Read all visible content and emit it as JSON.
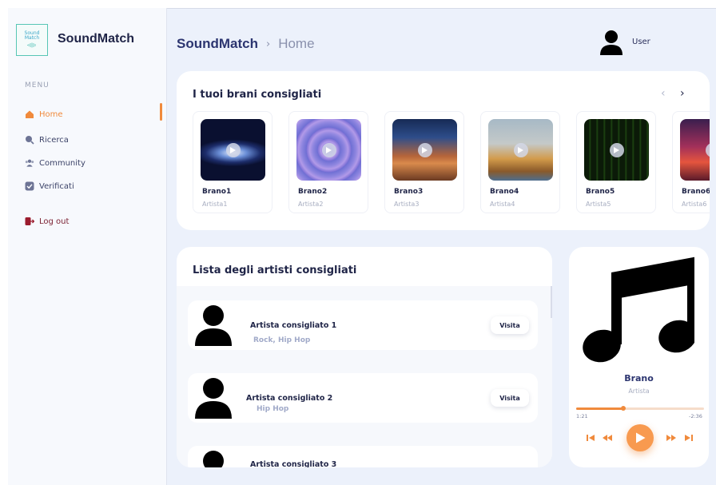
{
  "app": {
    "brand": "SoundMatch",
    "logo_text": "Sound Match",
    "colors": {
      "accent": "#f08a3c",
      "navy": "#2c3570",
      "logout": "#7a1f30"
    }
  },
  "sidebar": {
    "menu_label": "MENU",
    "items": [
      {
        "label": "Home",
        "icon": "home-icon",
        "active": true
      },
      {
        "label": "Ricerca",
        "icon": "search-icon",
        "active": false
      },
      {
        "label": "Community",
        "icon": "community-icon",
        "active": false
      },
      {
        "label": "Verificati",
        "icon": "verified-icon",
        "active": false
      }
    ],
    "logout_label": "Log out"
  },
  "header": {
    "breadcrumb_root": "SoundMatch",
    "breadcrumb_separator": "›",
    "breadcrumb_current": "Home",
    "user_name": "User"
  },
  "songs": {
    "title": "I tuoi brani consigliati",
    "prev_arrow": "‹",
    "next_arrow": "›",
    "items": [
      {
        "title": "Brano1",
        "artist": "Artista1"
      },
      {
        "title": "Brano2",
        "artist": "Artista2"
      },
      {
        "title": "Brano3",
        "artist": "Artista3"
      },
      {
        "title": "Brano4",
        "artist": "Artista4"
      },
      {
        "title": "Brano5",
        "artist": "Artista5"
      },
      {
        "title": "Brano6",
        "artist": "Artista6"
      }
    ]
  },
  "artists": {
    "title": "Lista degli artisti consigliati",
    "items": [
      {
        "name": "Artista consigliato 1",
        "genre": "Rock, Hip Hop",
        "visit_label": "Visita"
      },
      {
        "name": "Artista consigliato 2",
        "genre": "Hip Hop",
        "visit_label": "Visita"
      },
      {
        "name": "Artista consigliato 3",
        "genre": "",
        "visit_label": ""
      }
    ]
  },
  "player": {
    "title": "Brano",
    "artist": "Artista",
    "time_elapsed": "1:21",
    "time_remaining": "-2:36",
    "progress": 0.37
  }
}
